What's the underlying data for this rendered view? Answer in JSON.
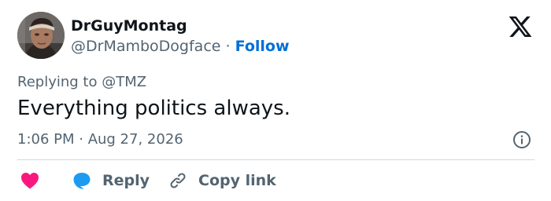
{
  "author": {
    "name": "DrGuyMontag",
    "handle": "@DrMamboDogface",
    "separator": "·",
    "follow_label": "Follow"
  },
  "reply_context": {
    "prefix": "Replying to",
    "mention": "@TMZ"
  },
  "tweet": {
    "text": "Everything politics always.",
    "timestamp": "1:06 PM · Aug 27, 2026"
  },
  "actions": {
    "reply_label": "Reply",
    "copy_link_label": "Copy link"
  },
  "colors": {
    "follow": "#006fd6",
    "heart": "#f91880",
    "reply_bubble": "#1d9bf0",
    "secondary_text": "#536471"
  },
  "icons": {
    "brand": "x-logo-icon",
    "info": "info-icon",
    "like": "heart-icon",
    "reply": "speech-bubble-icon",
    "copy_link": "link-icon"
  }
}
